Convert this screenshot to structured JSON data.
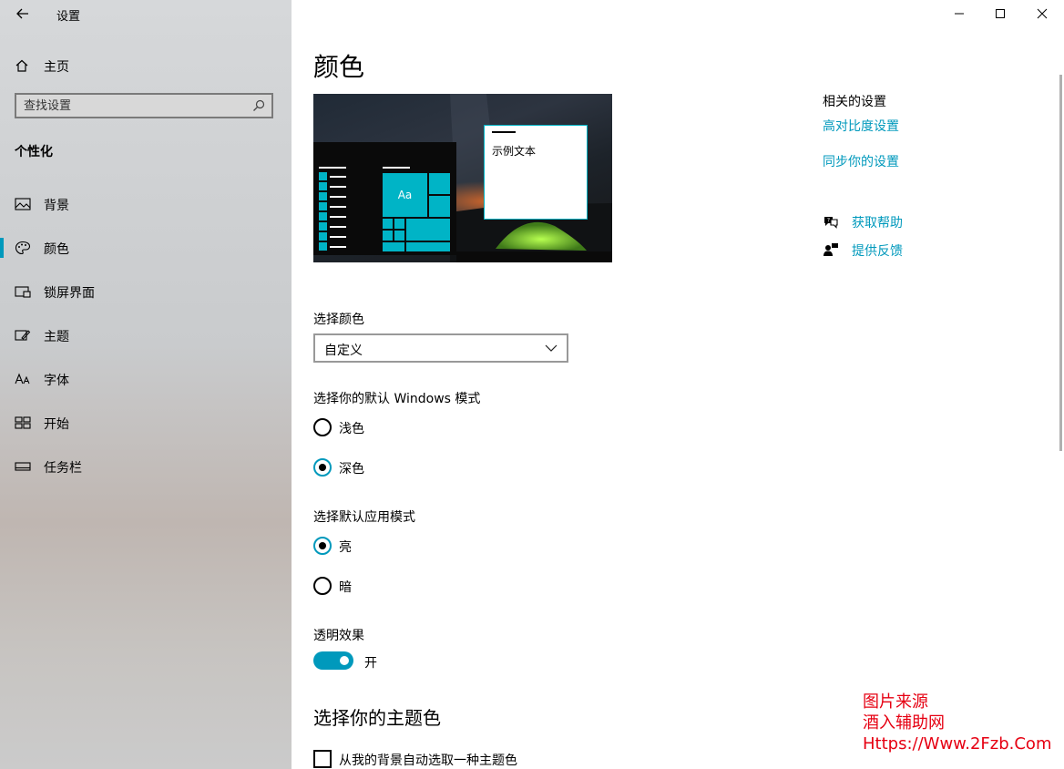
{
  "window": {
    "title": "设置",
    "controls": [
      "minimize-icon",
      "maximize-icon",
      "close-icon"
    ]
  },
  "sidebar": {
    "home_label": "主页",
    "search_placeholder": "查找设置",
    "section_title": "个性化",
    "items": [
      {
        "label": "背景",
        "icon": "picture-icon"
      },
      {
        "label": "颜色",
        "icon": "palette-icon",
        "active": true
      },
      {
        "label": "锁屏界面",
        "icon": "lock-screen-icon"
      },
      {
        "label": "主题",
        "icon": "theme-brush-icon"
      },
      {
        "label": "字体",
        "icon": "font-icon"
      },
      {
        "label": "开始",
        "icon": "start-grid-icon"
      },
      {
        "label": "任务栏",
        "icon": "taskbar-icon"
      }
    ]
  },
  "main": {
    "title": "颜色",
    "preview": {
      "sample_text": "示例文本",
      "tile_text": "Aa"
    },
    "choose_color": {
      "label": "选择颜色",
      "value": "自定义"
    },
    "windows_mode": {
      "label": "选择你的默认 Windows 模式",
      "options": [
        {
          "label": "浅色",
          "checked": false
        },
        {
          "label": "深色",
          "checked": true
        }
      ]
    },
    "app_mode": {
      "label": "选择默认应用模式",
      "options": [
        {
          "label": "亮",
          "checked": true
        },
        {
          "label": "暗",
          "checked": false
        }
      ]
    },
    "transparency": {
      "label": "透明效果",
      "state_label": "开",
      "on": true
    },
    "accent": {
      "title": "选择你的主题色",
      "auto_pick_label": "从我的背景自动选取一种主题色"
    }
  },
  "related": {
    "title": "相关的设置",
    "links": [
      "高对比度设置",
      "同步你的设置"
    ],
    "help_label": "获取帮助",
    "feedback_label": "提供反馈"
  },
  "watermark": {
    "line1": "图片来源",
    "line2": "酒入辅助网",
    "line3": "Https://Www.2Fzb.Com"
  },
  "colors": {
    "accent": "#0099bc",
    "link": "#0099bc",
    "watermark": "#e60012"
  }
}
